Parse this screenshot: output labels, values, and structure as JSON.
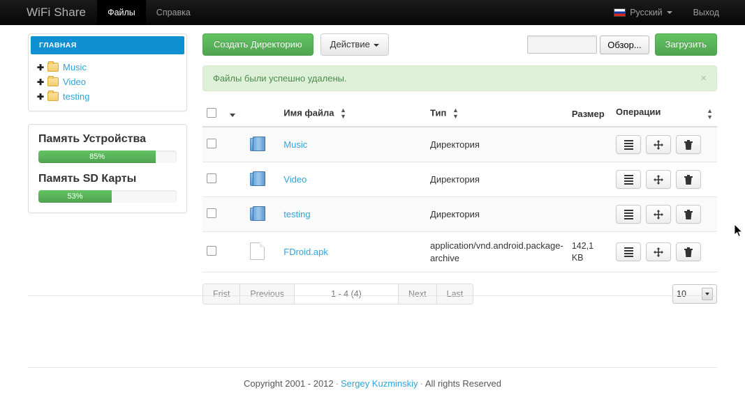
{
  "navbar": {
    "brand": "WiFi Share",
    "items": [
      {
        "label": "Файлы",
        "active": true
      },
      {
        "label": "Справка",
        "active": false
      }
    ],
    "language": "Русский",
    "logout": "Выход"
  },
  "sidebar": {
    "tree_title": "ГЛАВНАЯ",
    "tree_items": [
      {
        "label": "Music"
      },
      {
        "label": "Video"
      },
      {
        "label": "testing"
      }
    ],
    "memory": [
      {
        "label": "Память Устройства",
        "percent": 85,
        "text": "85%"
      },
      {
        "label": "Память SD Карты",
        "percent": 53,
        "text": "53%"
      }
    ]
  },
  "toolbar": {
    "create_dir": "Создать Директорию",
    "action": "Действие",
    "file_input_value": "",
    "browse": "Обзор...",
    "upload": "Загрузить"
  },
  "alert": {
    "message": "Файлы были успешно удалены.",
    "close": "×"
  },
  "table": {
    "headers": {
      "name": "Имя файла",
      "type": "Тип",
      "size": "Размер",
      "operations": "Операции"
    },
    "rows": [
      {
        "icon": "folder-icon",
        "name": "Music",
        "type": "Директория",
        "size": ""
      },
      {
        "icon": "folder-icon",
        "name": "Video",
        "type": "Директория",
        "size": ""
      },
      {
        "icon": "folder-icon",
        "name": "testing",
        "type": "Директория",
        "size": ""
      },
      {
        "icon": "document-icon",
        "name": "FDroid.apk",
        "type": "application/vnd.android.package-archive",
        "size": "142,1 KB"
      }
    ]
  },
  "pagination": {
    "first": "Frist",
    "previous": "Previous",
    "info": "1 - 4 (4)",
    "next": "Next",
    "last": "Last",
    "page_size": "10"
  },
  "footer": {
    "copyright": "Copyright 2001 - 2012",
    "author": "Sergey Kuzminskiy",
    "rights": "All rights Reserved"
  },
  "colors": {
    "navbar_bg": "#0e0e0e",
    "panel_title_bg": "#0e90d2",
    "link": "#2fa4d8",
    "success_green": "#51a351",
    "alert_bg": "#dff0d8",
    "alert_text": "#468847"
  }
}
